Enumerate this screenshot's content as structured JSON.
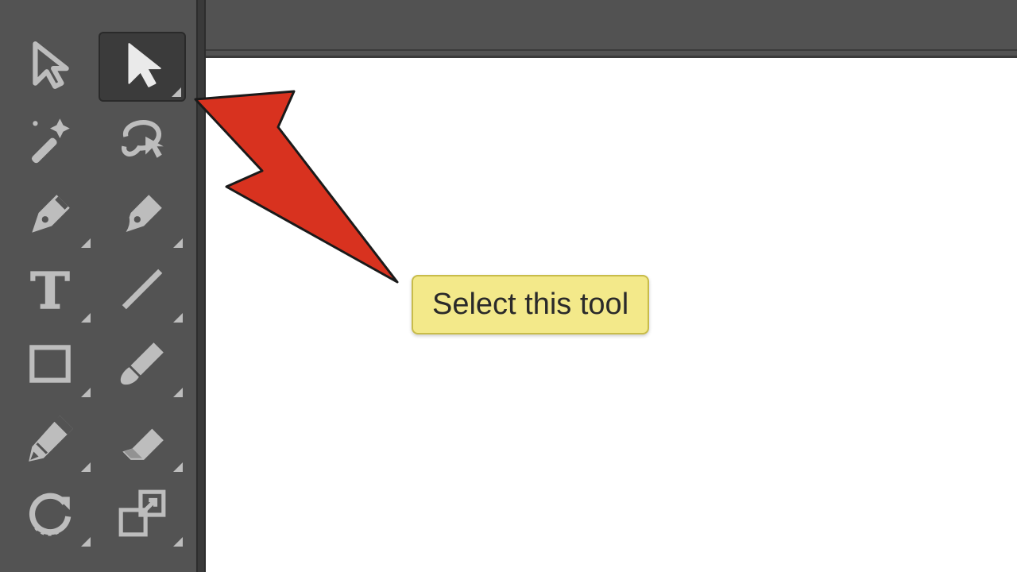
{
  "callout": {
    "text": "Select this tool"
  },
  "icons": {
    "selection": "selection-tool-icon",
    "direct_selection": "direct-selection-tool-icon",
    "magic_wand": "magic-wand-tool-icon",
    "lasso": "lasso-tool-icon",
    "pen": "pen-tool-icon",
    "curvature": "curvature-tool-icon",
    "type": "type-tool-icon",
    "line_segment": "line-segment-tool-icon",
    "rectangle": "rectangle-tool-icon",
    "paintbrush": "paintbrush-tool-icon",
    "pencil": "pencil-tool-icon",
    "eraser": "eraser-tool-icon",
    "rotate": "rotate-tool-icon",
    "scale": "scale-tool-icon"
  },
  "colors": {
    "toolbar_bg": "#535353",
    "selected_bg": "#3b3b3b",
    "icon": "#bdbdbd",
    "icon_selected": "#eaeaea",
    "arrow": "#d8321f",
    "callout_bg": "#f3e98a",
    "canvas": "#ffffff"
  }
}
